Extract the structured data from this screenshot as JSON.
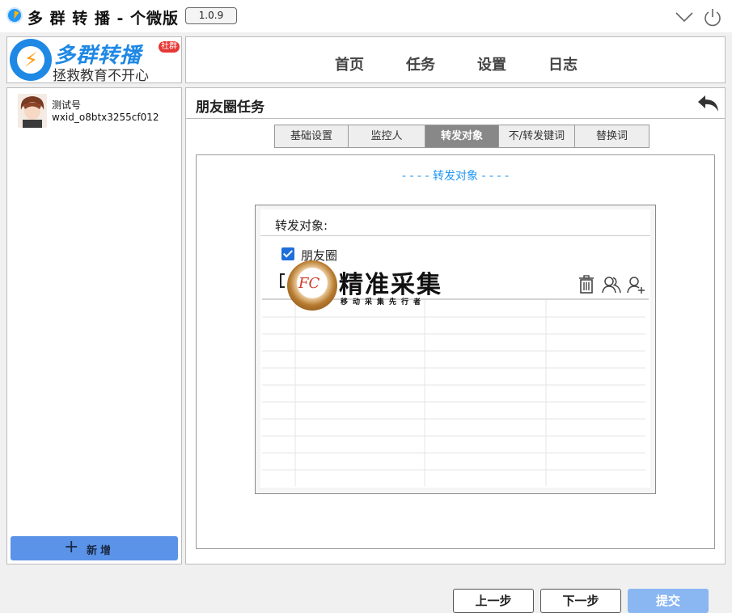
{
  "titlebar": {
    "title": "多 群 转 播 - 个微版",
    "version": "1.0.9",
    "icon_app": "lightning-compass-icon",
    "icon_collapse": "chevron-down-icon",
    "icon_power": "power-icon"
  },
  "logo": {
    "title": "多群转播",
    "tag": "社群",
    "slogan": "拯救教育不开心",
    "icon": "lightning-logo-icon",
    "colors": {
      "brand": "#1e88e5",
      "bolt": "#ff9800",
      "tag": "#e53935"
    }
  },
  "nav": {
    "items": [
      {
        "label": "首页"
      },
      {
        "label": "任务"
      },
      {
        "label": "设置"
      },
      {
        "label": "日志"
      }
    ]
  },
  "account": {
    "name": "测试号",
    "wxid": "wxid_o8btx3255cf012",
    "add_label": "新增",
    "add_icon": "plus-icon"
  },
  "main": {
    "title": "朋友圈任务",
    "back_icon": "undo-arrow-icon",
    "tabs": [
      {
        "label": "基础设置",
        "active": false
      },
      {
        "label": "监控人",
        "active": false
      },
      {
        "label": "转发对象",
        "active": true
      },
      {
        "label": "不/转发键词",
        "active": false
      },
      {
        "label": "替换词",
        "active": false
      }
    ],
    "section_heading": "- - - - 转发对象 - - - -",
    "target": {
      "label": "转发对象:",
      "moments_label": "朋友圈",
      "moments_checked": true,
      "group_checked": false,
      "icons": [
        "trash-icon",
        "members-icon",
        "add-member-icon"
      ]
    },
    "buttons": {
      "prev": "上一步",
      "next": "下一步",
      "submit": "提交"
    }
  },
  "watermark": {
    "seal_text": "FC",
    "title": "精准采集",
    "subtitle": "移动采集先行者"
  },
  "colors": {
    "accent": "#2196f3",
    "active_tab": "#888888",
    "add_button": "#5b93e8",
    "submit_button": "#8ab6f2"
  }
}
